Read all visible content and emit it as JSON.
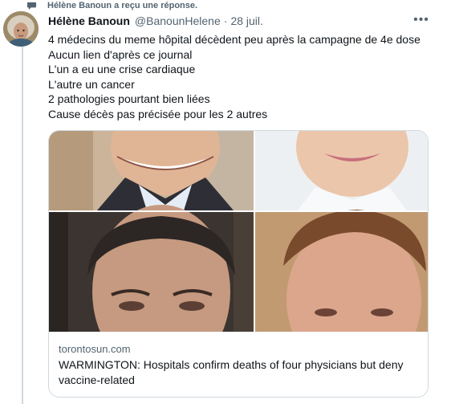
{
  "reply_notice": {
    "text": "Hélène Banoun a reçu une réponse.",
    "icon": "speech-bubble-icon"
  },
  "tweet": {
    "author_name": "Hélène Banoun",
    "handle": "@BanounHelene",
    "separator": "·",
    "date": "28 juil.",
    "more_icon": "more-dots-icon",
    "more_label": "•••",
    "lines": [
      "4 médecins du meme hôpital décèdent peu après la campagne de 4e dose",
      "Aucun lien d'après ce journal",
      "L'un a eu une crise cardiaque",
      "L'autre un cancer",
      "2 pathologies pourtant bien liées",
      "Cause décès pas précisée pour les 2 autres"
    ]
  },
  "card": {
    "domain": "torontosun.com",
    "title": "WARMINGTON: Hospitals confirm deaths of four physicians but deny vaccine-related"
  },
  "colors": {
    "text": "#0f1419",
    "secondary": "#536471",
    "border": "#cfd9de"
  }
}
